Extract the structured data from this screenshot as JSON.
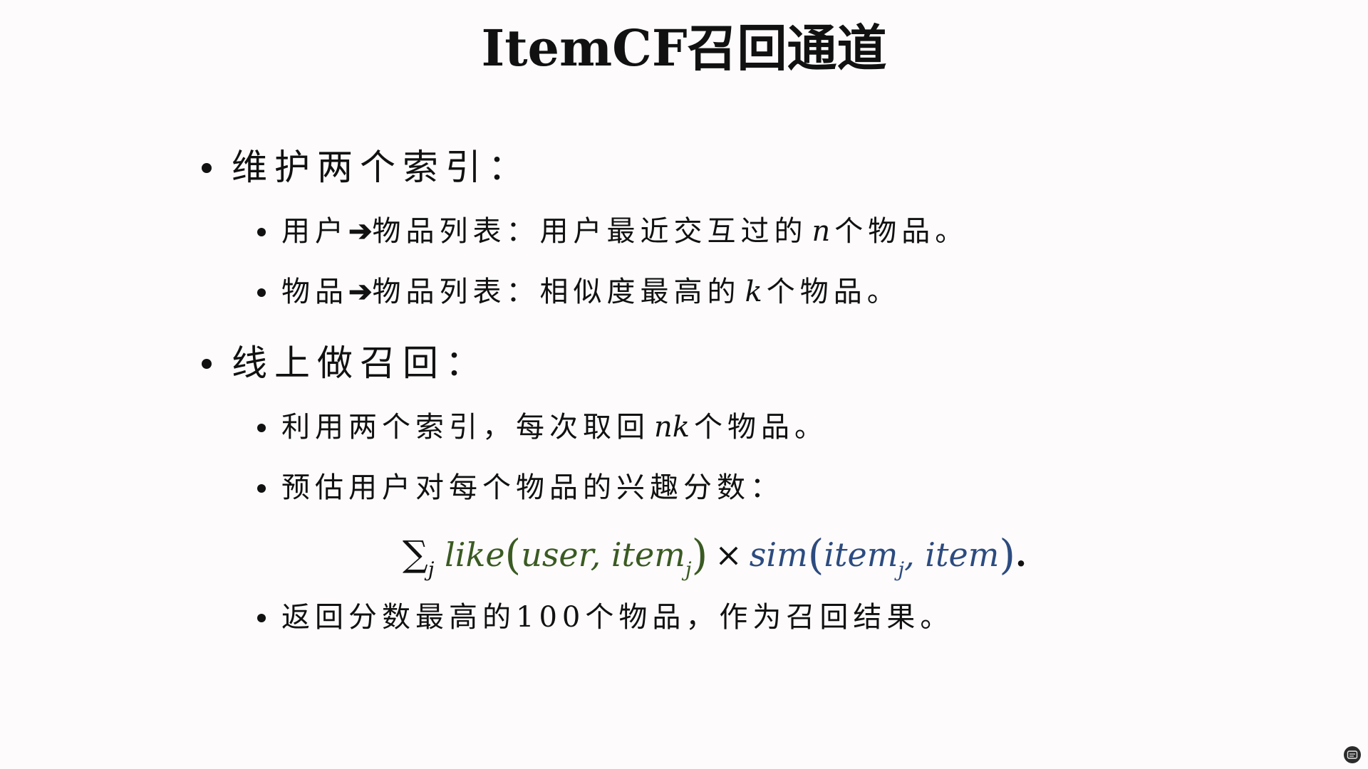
{
  "title": "ItemCF召回通道",
  "sections": [
    {
      "heading": "维护两个索引：",
      "items": [
        {
          "before": "用户",
          "arrow": "➔",
          "after": "物品列表：用户最近交互过的",
          "math": "n",
          "tail": "个物品。"
        },
        {
          "before": "物品",
          "arrow": "➔",
          "after": "物品列表：相似度最高的",
          "math": "k",
          "tail": "个物品。"
        }
      ]
    },
    {
      "heading": "线上做召回：",
      "items": [
        {
          "before": "利用两个索引，每次取回",
          "math": "nk",
          "tail": "个物品。"
        },
        {
          "text": "预估用户对每个物品的兴趣分数："
        },
        {
          "text": "返回分数最高的100个物品，作为召回结果。"
        }
      ]
    }
  ],
  "formula": {
    "sum": "∑",
    "sum_sub": "j",
    "like_fn": "like",
    "like_open": "(",
    "like_args_a": "user, item",
    "like_args_sub": "j",
    "like_close": ")",
    "times": "×",
    "sim_fn": "sim",
    "sim_open": "(",
    "sim_args_a": "item",
    "sim_args_sub": "j",
    "sim_args_b": ", item",
    "sim_close": ")",
    "end": "."
  },
  "colors": {
    "like": "#3a5a22",
    "sim": "#2c4b80",
    "text": "#111111",
    "background": "#fdfbfb"
  },
  "icons": {
    "corner_button": "caption-icon"
  }
}
